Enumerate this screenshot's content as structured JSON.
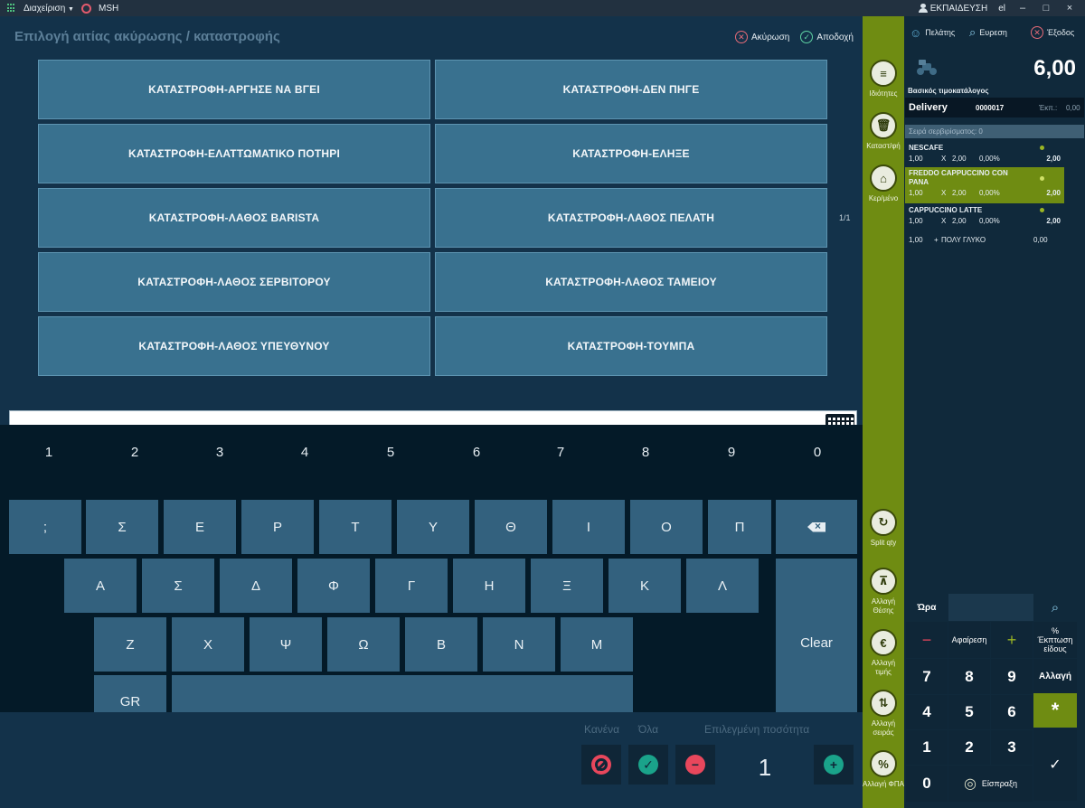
{
  "topbar": {
    "menu_label": "Διαχείριση",
    "app_label": "MSH",
    "user_label": "ΕΚΠΑΙΔΕΥΣΗ",
    "lang": "el",
    "min_glyph": "–",
    "max_glyph": "□",
    "close_glyph": "×"
  },
  "dialog": {
    "title": "Επιλογή αιτίας ακύρωσης / καταστροφής",
    "cancel_label": "Ακύρωση",
    "accept_label": "Αποδοχή",
    "page": "1/1",
    "reasons": [
      "ΚΑΤΑΣΤΡΟΦΗ-ΑΡΓΗΣΕ ΝΑ ΒΓΕΙ",
      "ΚΑΤΑΣΤΡΟΦΗ-ΔΕΝ ΠΗΓΕ",
      "ΚΑΤΑΣΤΡΟΦΗ-ΕΛΑΤΤΩΜΑΤΙΚΟ ΠΟΤΗΡΙ",
      "ΚΑΤΑΣΤΡΟΦΗ-ΕΛΗΞΕ",
      "ΚΑΤΑΣΤΡΟΦΗ-ΛΑΘΟΣ BARISTA",
      "ΚΑΤΑΣΤΡΟΦΗ-ΛΑΘΟΣ ΠΕΛΑΤΗ",
      "ΚΑΤΑΣΤΡΟΦΗ-ΛΑΘΟΣ ΣΕΡΒΙΤΟΡΟΥ",
      "ΚΑΤΑΣΤΡΟΦΗ-ΛΑΘΟΣ ΤΑΜΕΙΟΥ",
      "ΚΑΤΑΣΤΡΟΦΗ-ΛΑΘΟΣ ΥΠΕΥΘΥΝΟΥ",
      "ΚΑΤΑΣΤΡΟΦΗ-ΤΟΥΜΠΑ"
    ],
    "input_value": ""
  },
  "keyboard": {
    "numbers": [
      "1",
      "2",
      "3",
      "4",
      "5",
      "6",
      "7",
      "8",
      "9",
      "0"
    ],
    "row1": [
      ";",
      "Σ",
      "Ε",
      "Ρ",
      "Τ",
      "Υ",
      "Θ",
      "Ι",
      "Ο",
      "Π"
    ],
    "row2": [
      "Α",
      "Σ",
      "Δ",
      "Φ",
      "Γ",
      "Η",
      "Ξ",
      "Κ",
      "Λ"
    ],
    "row3": [
      "Ζ",
      "Χ",
      "Ψ",
      "Ω",
      "Β",
      "Ν",
      "Μ"
    ],
    "lang_key": "GR",
    "clear_key": "Clear"
  },
  "bottom": {
    "none_label": "Κανένα",
    "all_label": "Όλα",
    "qty_label": "Επιλεγμένη ποσότητα",
    "qty_value": "1",
    "minus_glyph": "−",
    "plus_glyph": "+",
    "check_glyph": "✓"
  },
  "tools": [
    {
      "label": "Ιδιότητες",
      "icon": "list-icon",
      "glyph": "≡"
    },
    {
      "label": "Καταστ/φή",
      "icon": "trash-icon",
      "glyph": "🗑"
    },
    {
      "label": "Κερ/μένο",
      "icon": "gift-icon",
      "glyph": "⌂"
    },
    {
      "label": "Split qty",
      "icon": "split-icon",
      "glyph": "↻"
    },
    {
      "label": "Αλλαγή Θέσης",
      "icon": "table-icon",
      "glyph": "⊼"
    },
    {
      "label": "Αλλαγή τιμής",
      "icon": "price-icon",
      "glyph": "€"
    },
    {
      "label": "Αλλαγή σειράς",
      "icon": "order-icon",
      "glyph": "⇅"
    },
    {
      "label": "Αλλαγή ΦΠΑ",
      "icon": "vat-icon",
      "glyph": "%"
    }
  ],
  "right": {
    "customer_label": "Πελάτης",
    "search_label": "Ευρεση",
    "exit_label": "Έξοδος",
    "total": "6,00",
    "pricelist": "Βασικός τιμοκατάλογος",
    "delivery_label": "Delivery",
    "delivery_no": "0000017",
    "disc_label": "Έκπ.:",
    "disc_value": "0,00",
    "serving_label": "Σειρά σερβιρίσματος: 0",
    "items": [
      {
        "name": "NESCAFE",
        "qty": "1,00",
        "x": "X",
        "price": "2,00",
        "pct": "0,00%",
        "total": "2,00",
        "selected": false
      },
      {
        "name": "FREDDO CAPPUCCINO CON PANA",
        "qty": "1,00",
        "x": "X",
        "price": "2,00",
        "pct": "0,00%",
        "total": "2,00",
        "selected": true
      },
      {
        "name": "CAPPUCCINO LATTE",
        "qty": "1,00",
        "x": "X",
        "price": "2,00",
        "pct": "0,00%",
        "total": "2,00",
        "selected": false
      }
    ],
    "modifier": {
      "qty": "1,00",
      "sign": "+",
      "name": "ΠΟΛΥ ΓΛΥΚΟ",
      "price": "0,00"
    }
  },
  "numpad": {
    "hour_label": "Ώρα",
    "remove_label": "Αφαίρεση",
    "discount_pct": "%",
    "discount_label": "Έκπτωση είδους",
    "change_label": "Αλλαγή",
    "pay_label": "Είσπραξη",
    "minus": "−",
    "plus": "+",
    "star": "*",
    "ok": "✓",
    "keys": [
      "7",
      "8",
      "9",
      "4",
      "5",
      "6",
      "1",
      "2",
      "3",
      "0"
    ]
  },
  "colors": {
    "accent_olive": "#6f8c12",
    "key_blue": "#33617e",
    "reason_blue": "#39718f",
    "danger": "#e8475c",
    "success": "#1aa38a"
  }
}
